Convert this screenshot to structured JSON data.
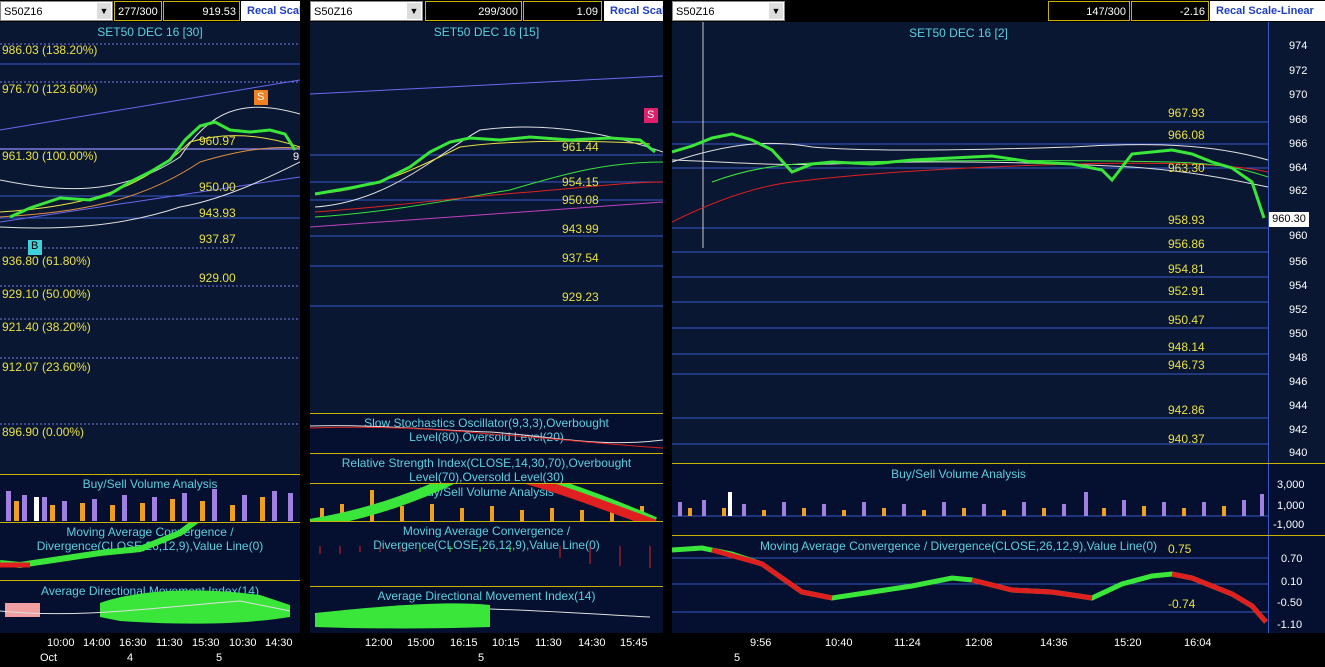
{
  "panels": [
    {
      "symbol": "S50Z16",
      "counter": "277/300",
      "price": "919.53",
      "recal_label": "Recal Scale",
      "title": "SET50 DEC 16  [30]",
      "fib_levels": [
        "986.03 (138.20%)",
        "976.70 (123.60%)",
        "961.30 (100.00%)",
        "936.80 (61.80%)",
        "929.10 (50.00%)",
        "921.40 (38.20%)",
        "912.07 (23.60%)",
        "896.90 (0.00%)"
      ],
      "price_levels": [
        "960.97",
        "950.00",
        "943.93",
        "937.87",
        "929.00"
      ],
      "buy_marker": "B",
      "sell_marker": "S",
      "right_edge_label": "9",
      "indicators": [
        "Buy/Sell Volume Analysis",
        "Moving Average Convergence / Divergence(CLOSE,26,12,9),Value Line(0)",
        "Average Directional Movement Index(14)"
      ],
      "time_labels": [
        "10:00",
        "14:00",
        "16:30",
        "11:30",
        "15:30",
        "10:30",
        "14:30"
      ],
      "date_labels": [
        "Oct",
        "4",
        "5"
      ]
    },
    {
      "symbol": "S50Z16",
      "counter": "299/300",
      "price": "1.09",
      "recal_label": "Recal Scale",
      "title": "SET50 DEC 16  [15]",
      "price_levels": [
        "961.44",
        "954.15",
        "950.08",
        "943.99",
        "937.54",
        "929.23"
      ],
      "sell_marker": "S",
      "indicators": [
        "Slow Stochastics Oscillator(9,3,3),Overbought Level(80),Oversold Level(20)",
        "Relative Strength Index(CLOSE,14,30,70),Overbought Level(70),Oversold Level(30)",
        "Buy/Sell Volume Analysis",
        "Moving Average Convergence / Divergence(CLOSE,26,12,9),Value Line(0)",
        "Average Directional Movement Index(14)"
      ],
      "time_labels": [
        "12:00",
        "15:00",
        "16:15",
        "10:15",
        "11:30",
        "14:30",
        "15:45"
      ],
      "date_labels": [
        "5"
      ]
    },
    {
      "symbol": "S50Z16",
      "counter": "147/300",
      "price": "-2.16",
      "recal_label": "Recal Scale-Linear",
      "title": "SET50 DEC 16  [2]",
      "price_levels": [
        "967.93",
        "966.08",
        "963.30",
        "958.93",
        "956.86",
        "954.81",
        "952.91",
        "950.47",
        "948.14",
        "946.73",
        "942.86",
        "940.37"
      ],
      "last_price": "960.30",
      "y_axis": [
        "974",
        "972",
        "970",
        "968",
        "966",
        "964",
        "962",
        "960",
        "958",
        "956",
        "954",
        "952",
        "950",
        "948",
        "946",
        "944",
        "942",
        "940"
      ],
      "volume_axis": [
        "3,000",
        "1,000",
        "-1,000"
      ],
      "macd_axis": [
        "0.70",
        "0.10",
        "-0.50",
        "-1.10"
      ],
      "macd_values": [
        "0.75",
        "-0.74"
      ],
      "indicators": [
        "Buy/Sell Volume Analysis",
        "Moving Average Convergence / Divergence(CLOSE,26,12,9),Value Line(0)"
      ],
      "time_labels": [
        "9:56",
        "10:40",
        "11:24",
        "12:08",
        "14:36",
        "15:20",
        "16:04"
      ],
      "date_labels": [
        "5"
      ]
    }
  ],
  "colors": {
    "background": "#0a1733",
    "level_text": "#e8e040",
    "title_text": "#5ad0e0",
    "bull": "#39e639",
    "bear": "#e02020"
  }
}
